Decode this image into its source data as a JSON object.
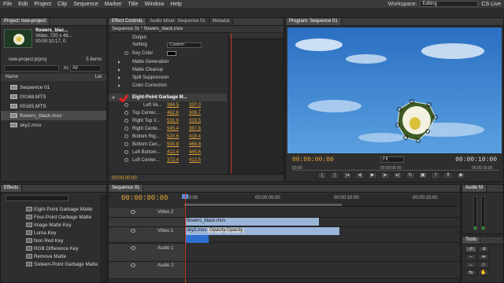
{
  "menubar": {
    "items": [
      "File",
      "Edit",
      "Project",
      "Clip",
      "Sequence",
      "Marker",
      "Title",
      "Window",
      "Help"
    ],
    "workspace_label": "Workspace:",
    "workspace_value": "Editing",
    "cs_live": "CS Live"
  },
  "project": {
    "tab": "Project: new-project",
    "clip_name": "flowers_blac...",
    "clip_info1": "Video, 720 x 48...",
    "clip_info2": "00:00:10:17, 0.",
    "clip_info3": "",
    "project_file": "new-project.prproj",
    "items_count": "5 Items",
    "in_label": "In:",
    "in_value": "All",
    "col_name": "Name",
    "col_label": "Lat",
    "items": [
      {
        "name": "Sequence 01"
      },
      {
        "name": "00168.MTS"
      },
      {
        "name": "00165.MTS"
      },
      {
        "name": "flowers_black.mov"
      },
      {
        "name": "sky2.mov"
      }
    ]
  },
  "effect_controls": {
    "tabs": [
      "Effect Controls",
      "Audio Mixer: Sequence 01",
      "Metadat"
    ],
    "header": "Sequence 01 * flowers_black.mov",
    "rows": {
      "output": "Output",
      "setting": "Setting",
      "setting_value": "Custom",
      "key_color": "Key Color",
      "matte_generation": "Matte Generation",
      "matte_cleanup": "Matte Cleanup",
      "spill_suppression": "Spill Suppression",
      "color_correction": "Color Correction",
      "garbage_matte": "Eight-Point Garbage M...",
      "points": [
        {
          "label": "Left Ve...",
          "x": "384.5",
          "y": "337.0"
        },
        {
          "label": "Top Center...",
          "x": "462.6",
          "y": "306.7"
        },
        {
          "label": "Right Top V...",
          "x": "531.6",
          "y": "319.5"
        },
        {
          "label": "Right Cente...",
          "x": "545.4",
          "y": "367.6"
        },
        {
          "label": "Bottom Rig...",
          "x": "520.6",
          "y": "418.4"
        },
        {
          "label": "Bottom Cen...",
          "x": "500.8",
          "y": "468.8"
        },
        {
          "label": "Left Bottom...",
          "x": "412.4",
          "y": "445.6"
        },
        {
          "label": "Left Center...",
          "x": "372.4",
          "y": "413.5"
        }
      ]
    },
    "footer_time": "00:00:00:00"
  },
  "program": {
    "tab": "Program: Sequence 01",
    "time_left": "00:00:00:00",
    "fit": "Fit",
    "time_right": "00:00:10:00",
    "ruler": [
      "00:00",
      "00:00:05:00",
      "00:00:10:00"
    ]
  },
  "effects": {
    "tab": "Effects",
    "items": [
      "Eight-Point Garbage Matte",
      "Four-Point Garbage Matte",
      "Image Matte Key",
      "Luma Key",
      "Non Red Key",
      "RGB Difference Key",
      "Remove Matte",
      "Sixteen-Point Garbage Matte"
    ]
  },
  "timeline": {
    "tab": "Sequence 01",
    "time": "00:00:00:00",
    "ruler": [
      "00:00",
      "00:00:05:00",
      "00:00:10:00",
      "00:00:15:00"
    ],
    "tracks": [
      {
        "name": "Video 2"
      },
      {
        "name": "Video 1"
      },
      {
        "name": "Audio 1"
      },
      {
        "name": "Audio 2"
      }
    ],
    "clips": {
      "flowers": "flowers_black.mov",
      "sky": "sky2.mov",
      "sky_opacity": "Opacity:Opacity"
    }
  },
  "audio_panel": {
    "tab": "Audio M"
  },
  "tools_panel": {
    "tab": "Tools"
  }
}
